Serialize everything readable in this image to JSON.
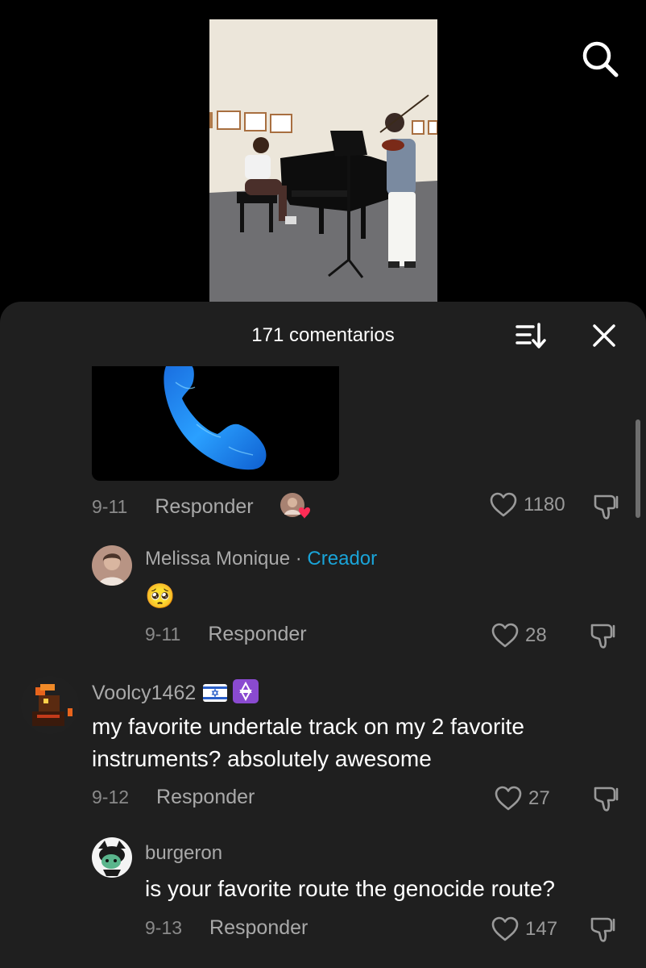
{
  "header": {
    "search_icon": "search-icon"
  },
  "video": {
    "description": "video-thumbnail"
  },
  "comments_sheet": {
    "title": "171 comentarios",
    "sort_icon": "sort-icon",
    "close_icon": "close-icon"
  },
  "comments": [
    {
      "date": "9-11",
      "reply_label": "Responder",
      "likes": "1180"
    },
    {
      "username": "Melissa Monique",
      "separator": " · ",
      "badge": "Creador",
      "text": "🥺",
      "date": "9-11",
      "reply_label": "Responder",
      "likes": "28"
    },
    {
      "username": "Voolcy1462",
      "text_line1": "my favorite undertale track on my 2 favorite",
      "text_line2": "instruments? absolutely awesome",
      "date": "9-12",
      "reply_label": "Responder",
      "likes": "27"
    },
    {
      "username": "burgeron",
      "text": "is your favorite route the genocide route?",
      "date": "9-13",
      "reply_label": "Responder",
      "likes": "147"
    }
  ],
  "colors": {
    "sheet_bg": "#1f1f1f",
    "creator_badge": "#1aa4d8",
    "liked_heart": "#fe2c55"
  }
}
